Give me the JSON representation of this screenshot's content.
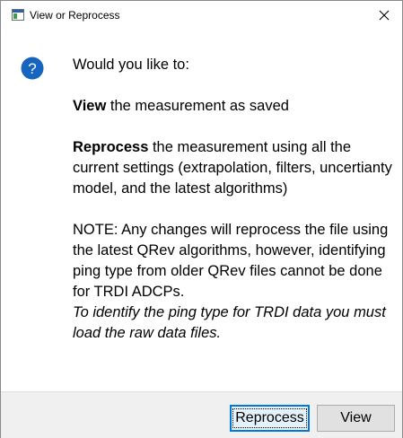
{
  "window": {
    "title": "View or Reprocess",
    "close_glyph": "✕"
  },
  "icons": {
    "app": "window-app-icon",
    "question": "question-icon",
    "question_color": "#1565c0"
  },
  "message": {
    "intro": "Would you like to:",
    "view_keyword": "View",
    "view_text": " the measurement as saved",
    "reprocess_keyword": "Reprocess",
    "reprocess_text": " the measurement using all the current settings (extrapolation, filters, uncertianty model, and the latest algorithms)",
    "note": "NOTE: Any changes will reprocess the file using the latest QRev algorithms, however, identifying ping type from older QRev files cannot be done for TRDI ADCPs.",
    "note_italic": "To identify the ping type for TRDI data you must load the raw data files."
  },
  "buttons": {
    "reprocess": "Reprocess",
    "view": "View"
  }
}
